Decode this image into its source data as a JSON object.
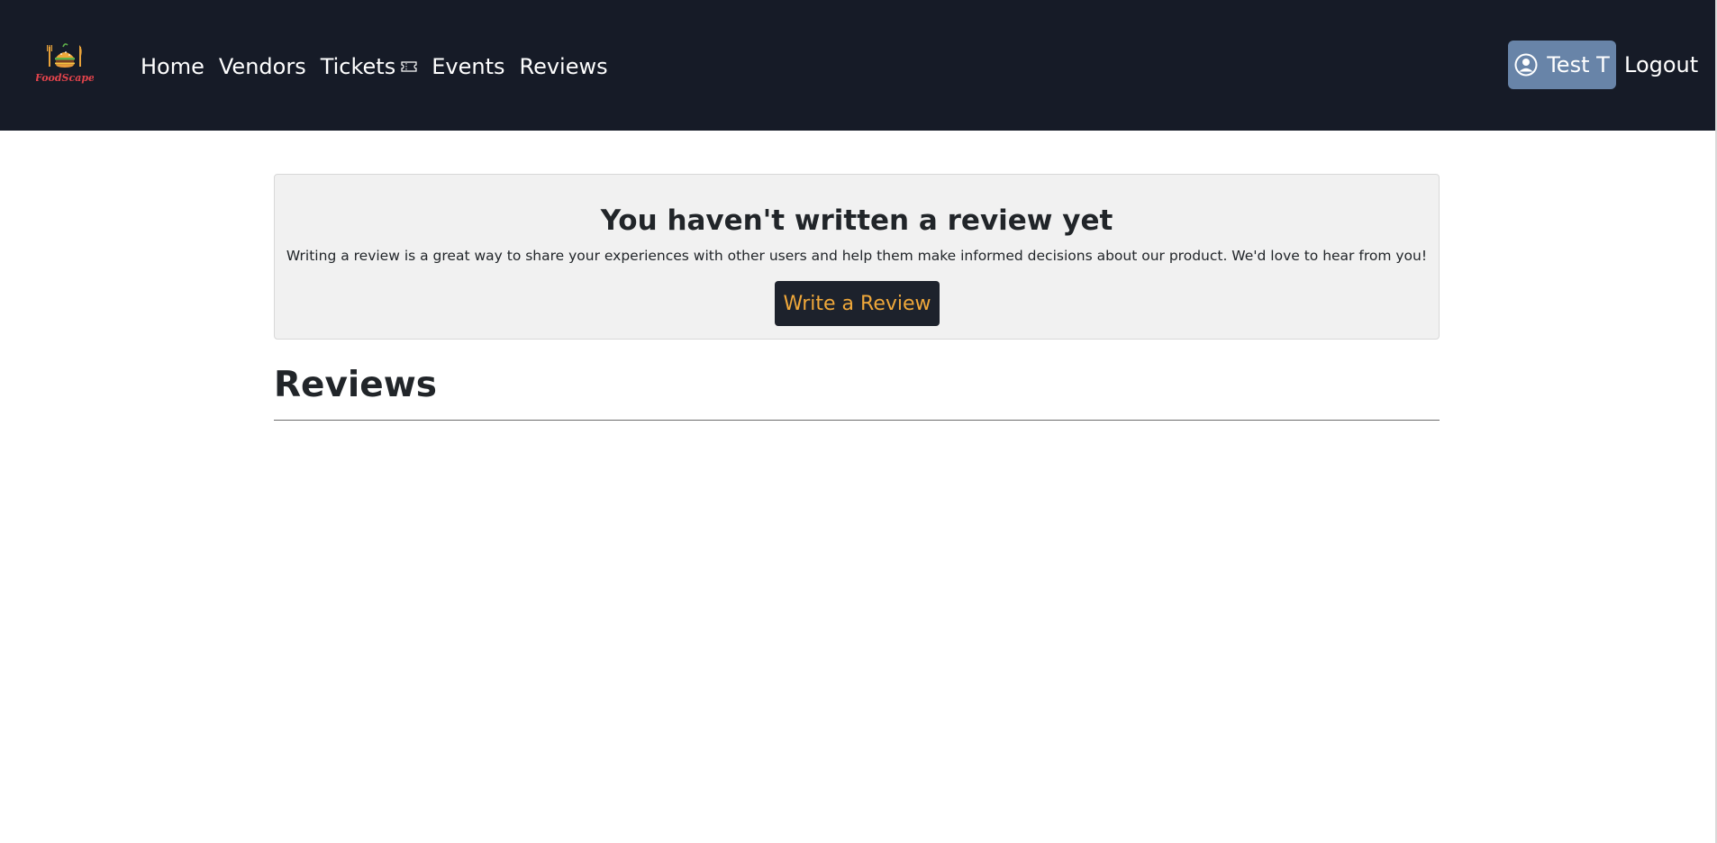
{
  "nav": {
    "brand": "FoodScape",
    "links": {
      "home": "Home",
      "vendors": "Vendors",
      "tickets": "Tickets",
      "events": "Events",
      "reviews": "Reviews"
    },
    "user_name": "Test T",
    "logout": "Logout"
  },
  "cta": {
    "title": "You haven't written a review yet",
    "text": "Writing a review is a great way to share your experiences with other users and help them make informed decisions about our product. We'd love to hear from you!",
    "button": "Write a Review"
  },
  "reviews": {
    "heading": "Reviews",
    "items": []
  },
  "colors": {
    "navbar_bg": "#161b27",
    "user_button_bg": "#6884a8",
    "cta_bg": "#f1f1f1",
    "button_bg": "#1d222c",
    "button_text": "#f0a83a",
    "logo_text": "#e0434b"
  }
}
